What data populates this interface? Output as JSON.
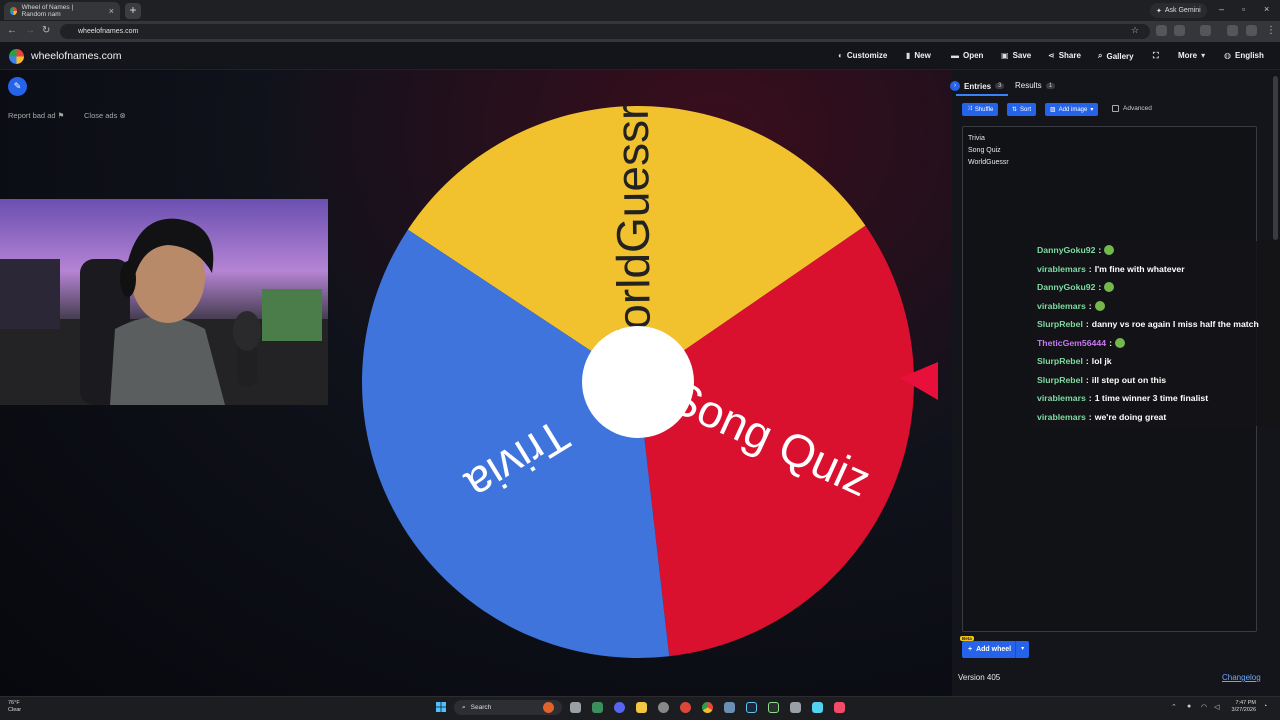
{
  "browser": {
    "tab_title": "Wheel of Names | Random nam",
    "url": "wheelofnames.com",
    "gemini_label": "Ask Gemini"
  },
  "site": {
    "name": "wheelofnames.com",
    "menu": [
      {
        "label": "Customize",
        "icon": "palette-icon"
      },
      {
        "label": "New",
        "icon": "file-icon"
      },
      {
        "label": "Open",
        "icon": "folder-icon"
      },
      {
        "label": "Save",
        "icon": "save-icon"
      },
      {
        "label": "Share",
        "icon": "share-icon"
      },
      {
        "label": "Gallery",
        "icon": "search-icon"
      },
      {
        "label": "More",
        "icon": "chevron-down-icon"
      },
      {
        "label": "English",
        "icon": "globe-icon"
      }
    ]
  },
  "ads": {
    "report": "Report bad ad",
    "close": "Close ads"
  },
  "wheel": {
    "segments": [
      {
        "label": "WorldGuessr",
        "color": "#f2c12e"
      },
      {
        "label": "Song Quiz",
        "color": "#d9102e"
      },
      {
        "label": "Trivia",
        "color": "#3f74dc"
      }
    ],
    "pointer_color": "#e8103a"
  },
  "panel": {
    "tabs": [
      {
        "label": "Entries",
        "count": "3"
      },
      {
        "label": "Results",
        "count": "1"
      }
    ],
    "buttons": {
      "shuffle": "Shuffle",
      "sort": "Sort",
      "add_image": "Add image",
      "advanced": "Advanced"
    },
    "entries": [
      "Trivia",
      "Song Quiz",
      "WorldGuessr"
    ],
    "add_wheel": "Add wheel",
    "beta": "Beta",
    "version": "Version 405",
    "changelog": "Changelog"
  },
  "chat": [
    {
      "user": "DannyGoku92",
      "color": "#7cdba0",
      "message": "",
      "emote": true
    },
    {
      "user": "virablemars",
      "color": "#7cdba0",
      "message": "I'm fine with whatever",
      "emote": false
    },
    {
      "user": "DannyGoku92",
      "color": "#7cdba0",
      "message": "",
      "emote": true
    },
    {
      "user": "virablemars",
      "color": "#7cdba0",
      "message": "",
      "emote": true
    },
    {
      "user": "SlurpRebel",
      "color": "#7cdba0",
      "message": "danny vs roe again I miss half the match",
      "emote": false
    },
    {
      "user": "TheticGem56444",
      "color": "#c678f0",
      "message": "",
      "emote": true
    },
    {
      "user": "SlurpRebel",
      "color": "#7cdba0",
      "message": "lol jk",
      "emote": false
    },
    {
      "user": "SlurpRebel",
      "color": "#7cdba0",
      "message": "ill step out on this",
      "emote": false
    },
    {
      "user": "virablemars",
      "color": "#7cdba0",
      "message": "1 time winner 3 time finalist",
      "emote": false
    },
    {
      "user": "virablemars",
      "color": "#7cdba0",
      "message": "we're doing great",
      "emote": false
    }
  ],
  "taskbar": {
    "weather_temp": "76°F",
    "weather_desc": "Clear",
    "search": "Search",
    "time": "7:47 PM",
    "date": "3/27/2026"
  }
}
